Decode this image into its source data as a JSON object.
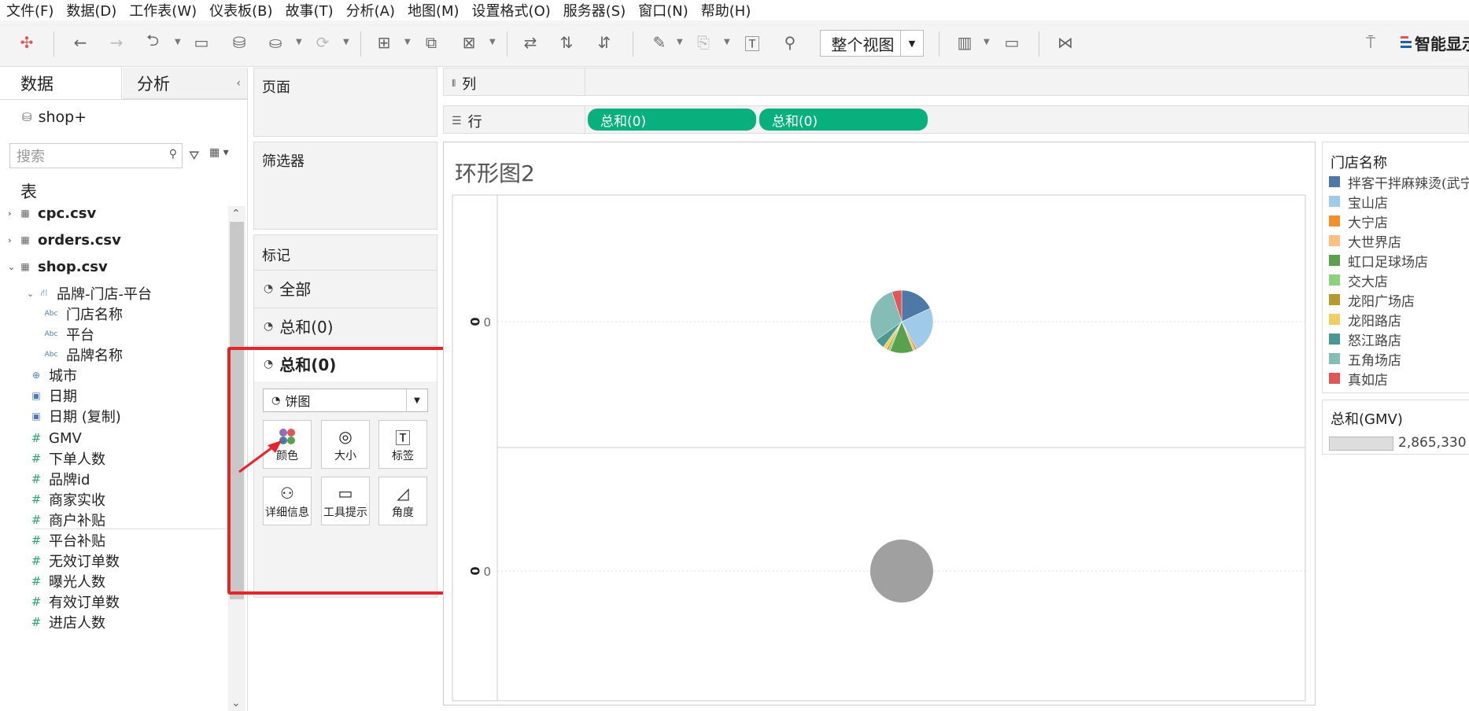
{
  "menu": [
    "文件(F)",
    "数据(D)",
    "工作表(W)",
    "仪表板(B)",
    "故事(T)",
    "分析(A)",
    "地图(M)",
    "设置格式(O)",
    "服务器(S)",
    "窗口(N)",
    "帮助(H)"
  ],
  "toolbar": {
    "view_select": "整个视图",
    "smart_label": "智能显示",
    "icons": [
      "tableau-logo-icon",
      "back-icon",
      "forward-icon",
      "redo-icon",
      "save-icon",
      "new-datasource-icon",
      "pause-icon",
      "refresh-icon",
      "new-sheet-icon",
      "duplicate-icon",
      "clear-icon",
      "swap-icon",
      "sort-asc-icon",
      "sort-desc-icon",
      "highlight-icon",
      "group-icon",
      "label-icon",
      "pin-icon",
      "show-cards-icon",
      "presentation-icon",
      "share-icon",
      "format-painter-icon"
    ]
  },
  "data_panel": {
    "tab_data": "数据",
    "tab_analysis": "分析",
    "datasource": "shop+",
    "search_placeholder": "搜索",
    "section_tables": "表",
    "fields": [
      {
        "label": "cpc.csv",
        "type": "table"
      },
      {
        "label": "orders.csv",
        "type": "table"
      },
      {
        "label": "shop.csv",
        "type": "table-open"
      },
      {
        "label": "品牌-门店-平台",
        "type": "hierarchy"
      },
      {
        "label": "门店名称",
        "type": "abc"
      },
      {
        "label": "平台",
        "type": "abc"
      },
      {
        "label": "品牌名称",
        "type": "abc"
      },
      {
        "label": "城市",
        "type": "geo"
      },
      {
        "label": "日期",
        "type": "date"
      },
      {
        "label": "日期 (复制)",
        "type": "date2"
      },
      {
        "label": "GMV",
        "type": "measure"
      },
      {
        "label": "下单人数",
        "type": "measure"
      },
      {
        "label": "品牌id",
        "type": "measure"
      },
      {
        "label": "商家实收",
        "type": "measure"
      },
      {
        "label": "商户补贴",
        "type": "measure"
      },
      {
        "label": "平台补贴",
        "type": "measure"
      },
      {
        "label": "无效订单数",
        "type": "measure"
      },
      {
        "label": "曝光人数",
        "type": "measure"
      },
      {
        "label": "有效订单数",
        "type": "measure"
      },
      {
        "label": "进店人数",
        "type": "measure"
      }
    ]
  },
  "cards": {
    "pages": "页面",
    "filters": "筛选器",
    "marks": "标记",
    "marks_rows": [
      "全部",
      "总和(0)",
      "总和(0)"
    ],
    "mark_type": "饼图",
    "buttons": [
      {
        "label": "颜色",
        "icon": "color-icon"
      },
      {
        "label": "大小",
        "icon": "size-icon"
      },
      {
        "label": "标签",
        "icon": "label-icon"
      },
      {
        "label": "详细信息",
        "icon": "detail-icon"
      },
      {
        "label": "工具提示",
        "icon": "tooltip-icon"
      },
      {
        "label": "角度",
        "icon": "angle-icon"
      }
    ]
  },
  "shelves": {
    "columns_label": "列",
    "rows_label": "行",
    "row_pills": [
      "总和(0)",
      "总和(0)"
    ]
  },
  "view": {
    "title": "环形图2",
    "axis_label": "0",
    "tick": "0"
  },
  "legend": {
    "title": "门店名称",
    "items": [
      {
        "name": "拌客干拌麻辣烫(武宁",
        "color": "#4e79a7"
      },
      {
        "name": "宝山店",
        "color": "#a0cbe8"
      },
      {
        "name": "大宁店",
        "color": "#f28e2b"
      },
      {
        "name": "大世界店",
        "color": "#ffbe7d"
      },
      {
        "name": "虹口足球场店",
        "color": "#59a14f"
      },
      {
        "name": "交大店",
        "color": "#8cd17d"
      },
      {
        "name": "龙阳广场店",
        "color": "#b6992d"
      },
      {
        "name": "龙阳路店",
        "color": "#f1ce63"
      },
      {
        "name": "怒江路店",
        "color": "#499894"
      },
      {
        "name": "五角场店",
        "color": "#86bcb6"
      },
      {
        "name": "真如店",
        "color": "#e15759"
      }
    ]
  },
  "size_legend": {
    "title": "总和(GMV)",
    "value": "2,865,330"
  },
  "chart_data": {
    "type": "pie",
    "categories": [
      "拌客干拌麻辣烫(武宁",
      "宝山店",
      "大宁店",
      "大世界店",
      "虹口足球场店",
      "交大店",
      "龙阳广场店",
      "龙阳路店",
      "怒江路店",
      "五角场店",
      "真如店"
    ],
    "values": [
      0.18,
      0.24,
      0.01,
      0.01,
      0.12,
      0.01,
      0.01,
      0.02,
      0.05,
      0.3,
      0.05
    ],
    "second_pie": {
      "color": "#a0a0a0"
    }
  }
}
